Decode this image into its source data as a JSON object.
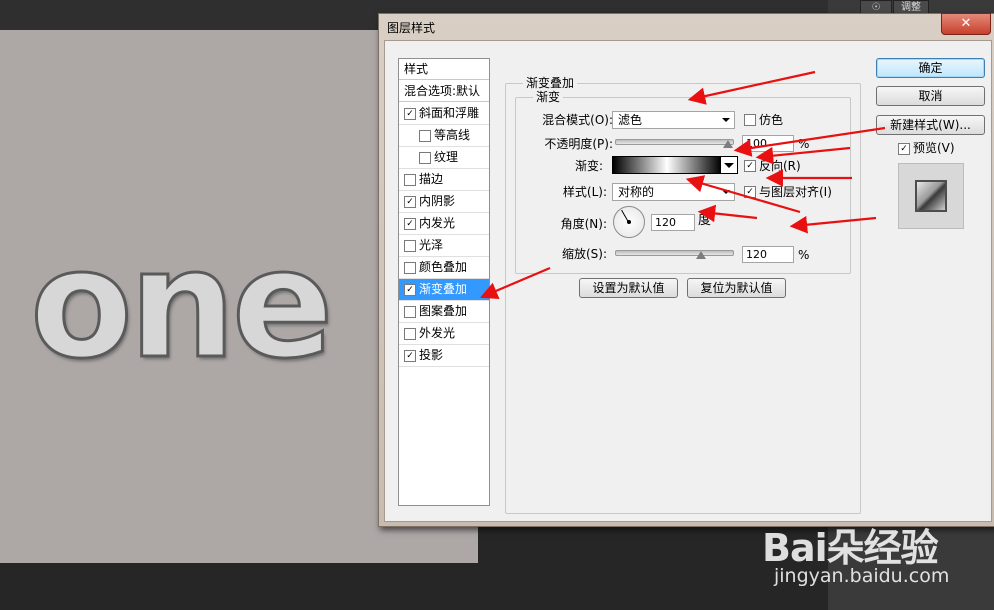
{
  "photoshop": {
    "panel_button_1": "☉",
    "panel_button_2": "调整",
    "canvas_text": "one"
  },
  "dialog": {
    "title": "图层样式",
    "close_symbol": "✕",
    "style_list": {
      "header": "样式",
      "blend_options": "混合选项:默认",
      "items": [
        {
          "label": "斜面和浮雕",
          "checked": true,
          "indent": false
        },
        {
          "label": "等高线",
          "checked": false,
          "indent": true
        },
        {
          "label": "纹理",
          "checked": false,
          "indent": true
        },
        {
          "label": "描边",
          "checked": false,
          "indent": false
        },
        {
          "label": "内阴影",
          "checked": true,
          "indent": false
        },
        {
          "label": "内发光",
          "checked": true,
          "indent": false
        },
        {
          "label": "光泽",
          "checked": false,
          "indent": false
        },
        {
          "label": "颜色叠加",
          "checked": false,
          "indent": false
        },
        {
          "label": "渐变叠加",
          "checked": true,
          "indent": false,
          "selected": true
        },
        {
          "label": "图案叠加",
          "checked": false,
          "indent": false
        },
        {
          "label": "外发光",
          "checked": false,
          "indent": false
        },
        {
          "label": "投影",
          "checked": true,
          "indent": false
        }
      ]
    },
    "gradient_overlay": {
      "group_title": "渐变叠加",
      "subgroup_title": "渐变",
      "blend_mode_label": "混合模式(O):",
      "blend_mode_value": "滤色",
      "dither_label": "仿色",
      "dither_checked": false,
      "opacity_label": "不透明度(P):",
      "opacity_value": "100",
      "opacity_unit": "%",
      "gradient_label": "渐变:",
      "reverse_label": "反向(R)",
      "reverse_checked": true,
      "style_label": "样式(L):",
      "style_value": "对称的",
      "align_label": "与图层对齐(I)",
      "align_checked": true,
      "angle_label": "角度(N):",
      "angle_value": "120",
      "angle_unit": "度",
      "scale_label": "缩放(S):",
      "scale_value": "120",
      "scale_unit": "%",
      "set_default_button": "设置为默认值",
      "reset_default_button": "复位为默认值"
    },
    "buttons": {
      "ok": "确定",
      "cancel": "取消",
      "new_style": "新建样式(W)...",
      "preview_label": "预览(V)",
      "preview_checked": true
    }
  },
  "watermark": {
    "logo": "Bai朵经验",
    "url": "jingyan.baidu.com"
  },
  "colors": {
    "arrow_red": "#e81010",
    "selection_blue": "#3399ff"
  }
}
